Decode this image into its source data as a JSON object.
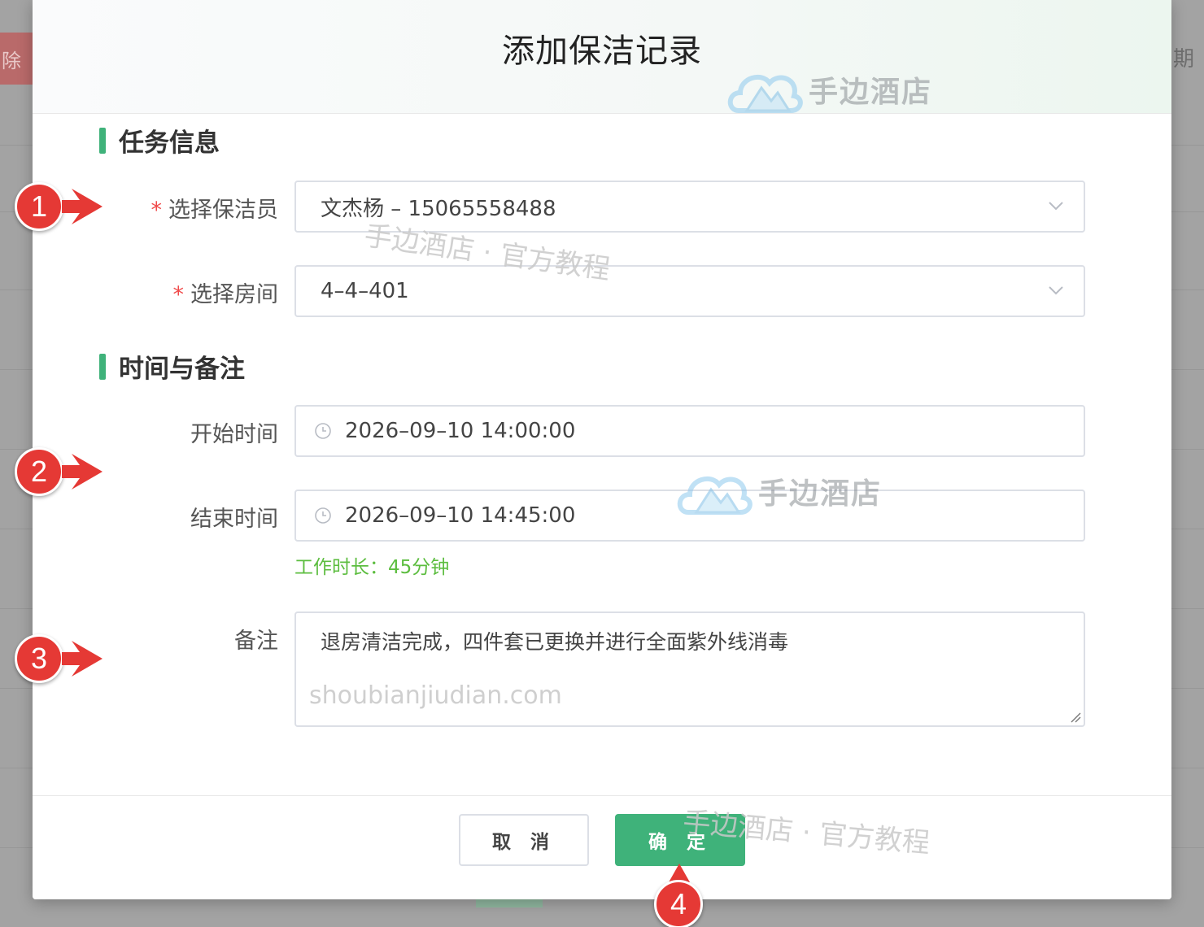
{
  "background": {
    "left_button_fragment": "除",
    "right_text_fragment": "期"
  },
  "dialog": {
    "title": "添加保洁记录",
    "section_task": "任务信息",
    "section_time": "时间与备注",
    "cleaner": {
      "label": "选择保洁员",
      "required_mark": "*",
      "value": "文杰杨 – 15065558488"
    },
    "room": {
      "label": "选择房间",
      "required_mark": "*",
      "value": "4–4–401"
    },
    "start_time": {
      "label": "开始时间",
      "value": "2026–09–10 14:00:00"
    },
    "end_time": {
      "label": "结束时间",
      "value": "2026–09–10 14:45:00"
    },
    "duration_text": "工作时长：45分钟",
    "remark": {
      "label": "备注",
      "value": "退房清洁完成，四件套已更换并进行全面紫外线消毒"
    },
    "cancel_label": "取 消",
    "confirm_label": "确 定"
  },
  "watermarks": {
    "brand": "手边酒店",
    "caption": "手边酒店 · 官方教程",
    "url": "shoubianjiudian.com"
  },
  "markers": [
    "1",
    "2",
    "3",
    "4"
  ],
  "colors": {
    "accent_green": "#3fb27a",
    "duration_green": "#5cbd3f",
    "required_red": "#f04a4a",
    "marker_red": "#e53935"
  },
  "icons": {
    "select_arrow": "chevron-down-icon",
    "time_prefix": "clock-icon",
    "brand_logo": "cloud-mountain-logo"
  }
}
